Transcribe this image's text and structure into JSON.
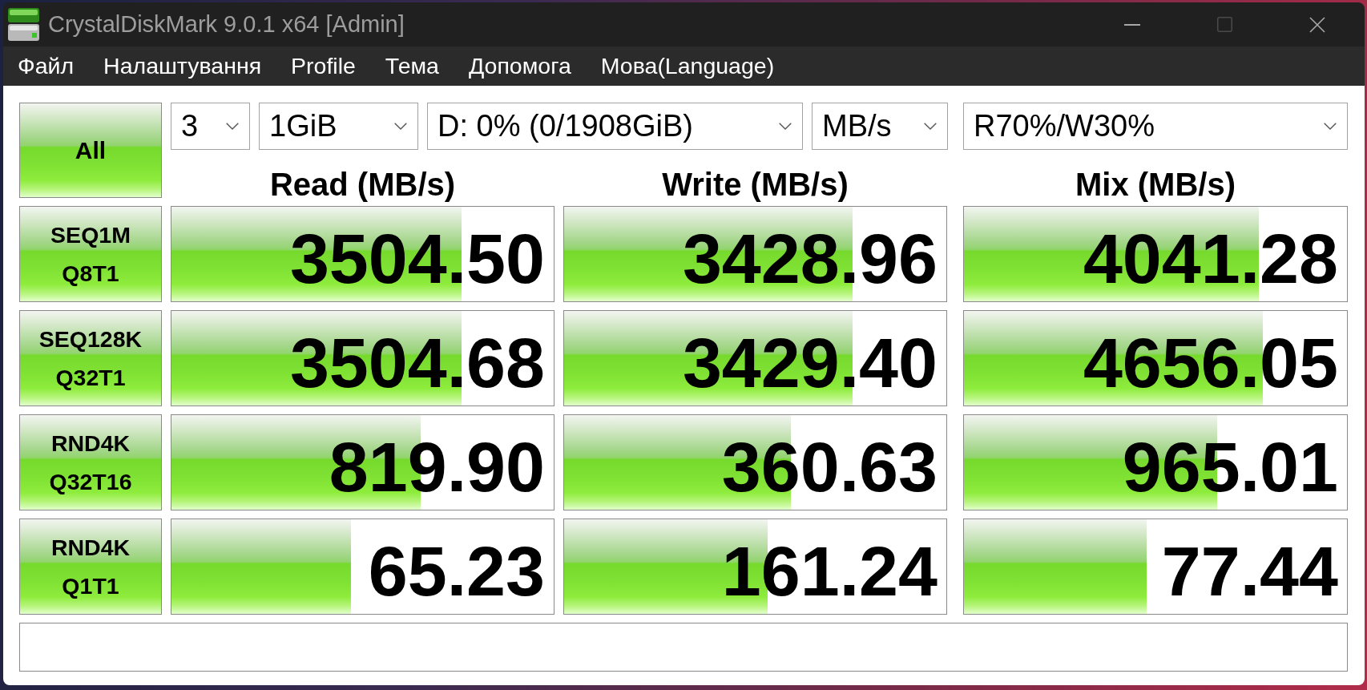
{
  "window": {
    "title": "CrystalDiskMark 9.0.1 x64 [Admin]",
    "controls": [
      {
        "kind": "minimize",
        "disabled": false
      },
      {
        "kind": "maximize",
        "disabled": true
      },
      {
        "kind": "close",
        "disabled": false
      }
    ]
  },
  "menu": [
    "Файл",
    "Налаштування",
    "Profile",
    "Тема",
    "Допомога",
    "Мова(Language)"
  ],
  "benchmark": {
    "all_button": "All",
    "dropdowns": [
      {
        "value": "3"
      },
      {
        "value": "1GiB"
      },
      {
        "value": "D: 0% (0/1908GiB)"
      },
      {
        "value": "MB/s"
      },
      {
        "value": "R70%/W30%"
      }
    ],
    "columns": [
      "Read (MB/s)",
      "Write (MB/s)",
      "Mix (MB/s)"
    ],
    "rows": [
      {
        "label_lines": [
          "SEQ1M",
          "Q8T1"
        ],
        "results": [
          {
            "value": "3504.50",
            "level": 0.759
          },
          {
            "value": "3428.96",
            "level": 0.755
          },
          {
            "value": "4041.28",
            "level": 0.769
          }
        ]
      },
      {
        "label_lines": [
          "SEQ128K",
          "Q32T1"
        ],
        "results": [
          {
            "value": "3504.68",
            "level": 0.759
          },
          {
            "value": "3429.40",
            "level": 0.755
          },
          {
            "value": "4656.05",
            "level": 0.78
          }
        ]
      },
      {
        "label_lines": [
          "RND4K",
          "Q32T16"
        ],
        "results": [
          {
            "value": "819.90",
            "level": 0.652
          },
          {
            "value": "360.63",
            "level": 0.593
          },
          {
            "value": "965.01",
            "level": 0.662
          }
        ]
      },
      {
        "label_lines": [
          "RND4K",
          "Q1T1"
        ],
        "results": [
          {
            "value": "65.23",
            "level": 0.469
          },
          {
            "value": "161.24",
            "level": 0.532
          },
          {
            "value": "77.44",
            "level": 0.477
          }
        ]
      }
    ]
  }
}
